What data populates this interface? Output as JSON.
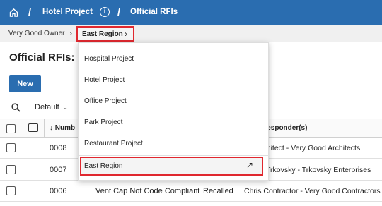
{
  "topbar": {
    "home_icon": "home-icon",
    "separator": "/",
    "project": "Hotel Project",
    "info_icon": "info-icon",
    "info_glyph": "i",
    "tool": "Official RFIs"
  },
  "breadcrumb": {
    "owner": "Very Good Owner",
    "region": "East Region",
    "chevron": "›"
  },
  "page": {
    "title": "Official RFIs: Co",
    "new_button": "New"
  },
  "toolbar": {
    "search_icon": "search-icon",
    "view": "Default",
    "view_chevron": "⌄"
  },
  "table": {
    "header": {
      "number": "Numb",
      "responders": "Responder(s)",
      "sort_icon": "arrow-down-icon"
    },
    "rows": [
      {
        "number": "0008",
        "subject": "",
        "status": "",
        "responder": "rchitect - Very Good Architects"
      },
      {
        "number": "0007",
        "subject": "",
        "status": "",
        "responder": "Trkovsky - Trkovsky Enterprises"
      },
      {
        "number": "0006",
        "subject": "Vent Cap Not Code Compliant",
        "status": "Recalled",
        "responder": "Chris Contractor - Very Good Contractors"
      }
    ]
  },
  "dropdown": {
    "items": [
      {
        "label": "Hospital Project"
      },
      {
        "label": "Hotel Project"
      },
      {
        "label": "Office Project"
      },
      {
        "label": "Park Project"
      },
      {
        "label": "Restaurant Project"
      }
    ],
    "region_link": {
      "label": "East Region",
      "icon": "external-arrow-icon",
      "glyph": "↗"
    }
  },
  "colors": {
    "brand_blue": "#2a6db0",
    "highlight_red": "#e0282f"
  }
}
